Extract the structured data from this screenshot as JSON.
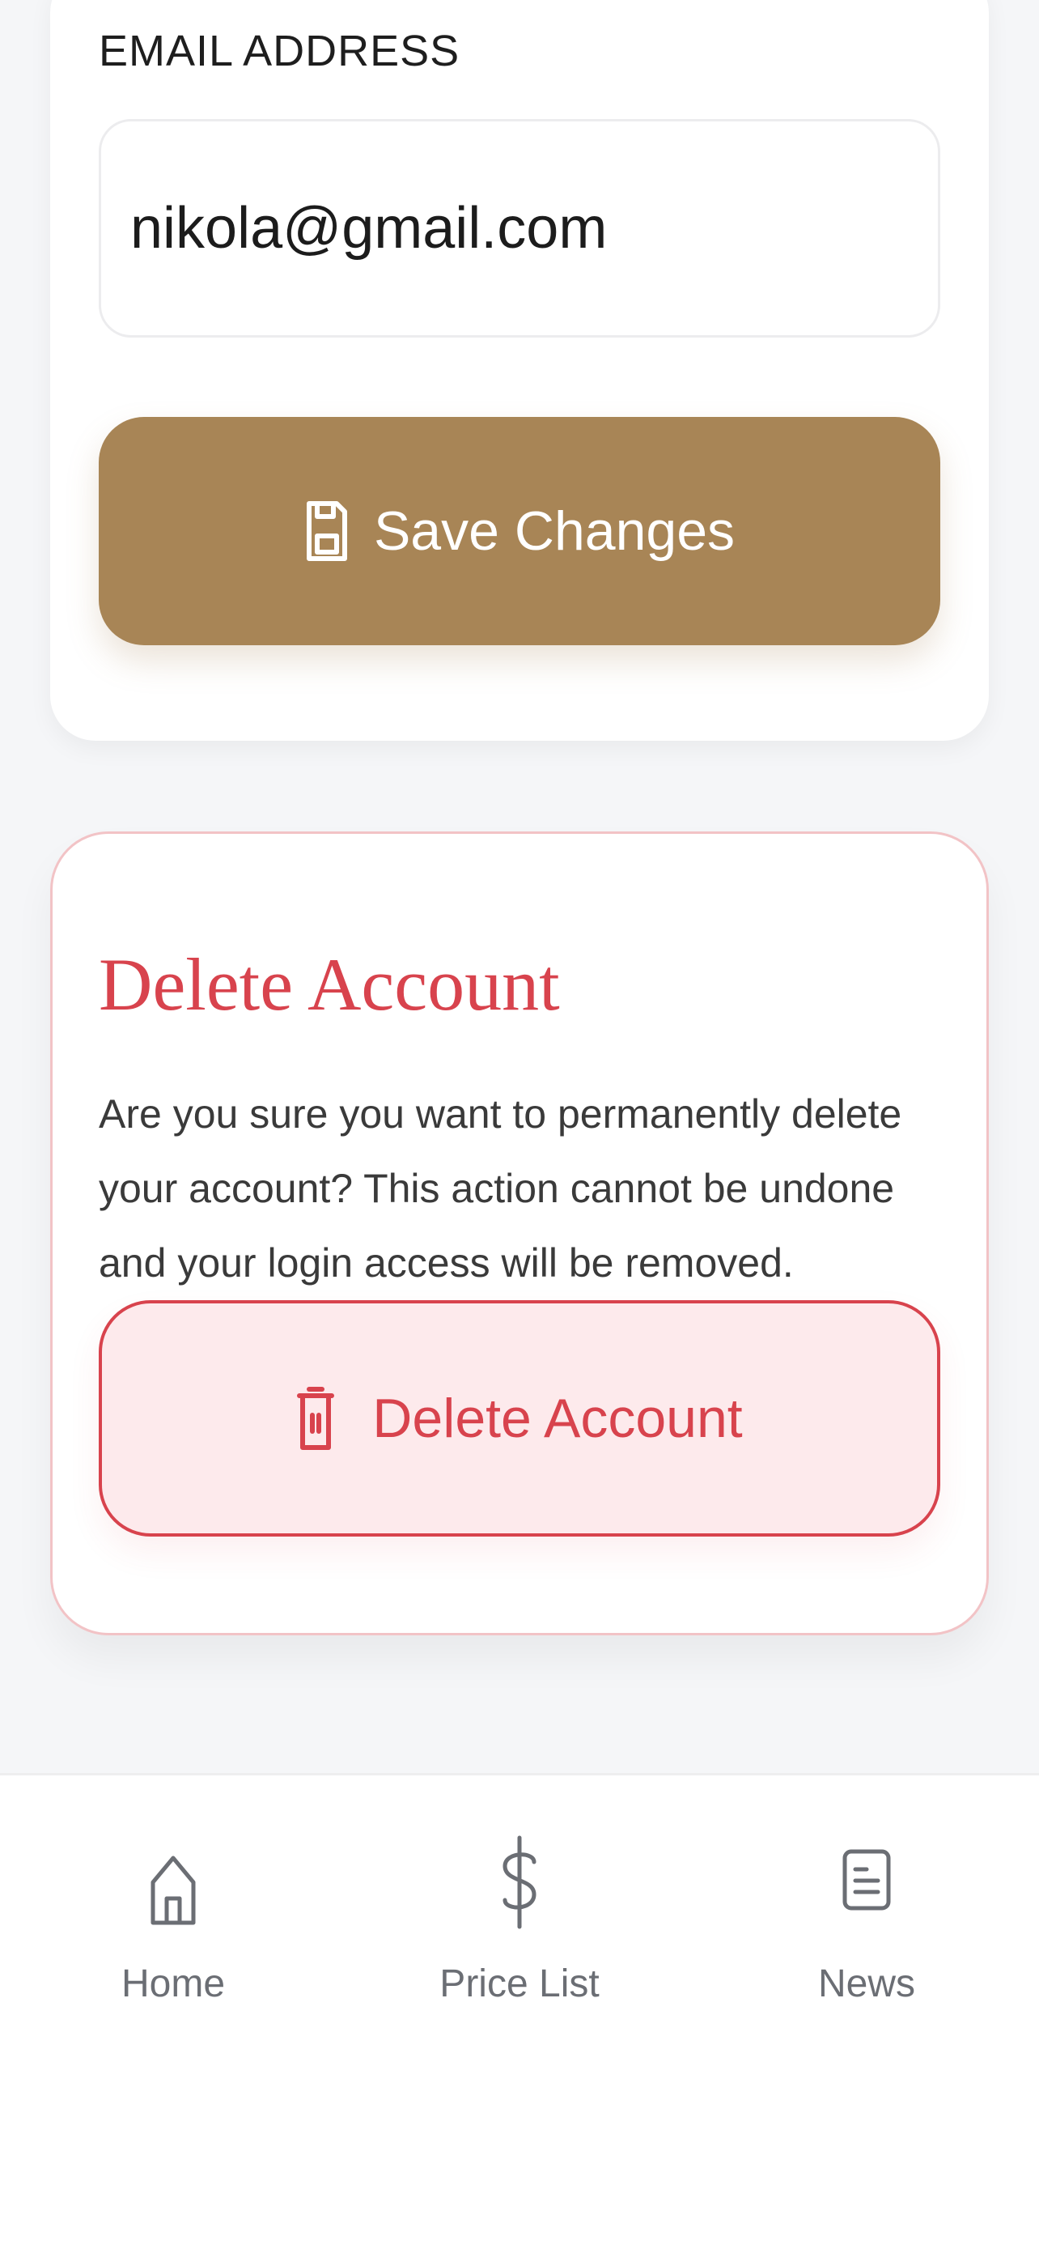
{
  "profile": {
    "email_label": "EMAIL ADDRESS",
    "email_value": "nikola@gmail.com",
    "save_label": "Save Changes"
  },
  "delete_section": {
    "title": "Delete Account",
    "description": "Are you sure you want to permanently delete your account? This action cannot be undone and your login access will be removed.",
    "button_label": "Delete Account"
  },
  "bottom_nav": {
    "items": [
      {
        "label": "Home",
        "icon": "home-icon"
      },
      {
        "label": "Price List",
        "icon": "dollar-icon"
      },
      {
        "label": "News",
        "icon": "news-icon"
      }
    ]
  },
  "colors": {
    "accent": "#a88556",
    "danger": "#d8434d",
    "danger_bg": "#fdeaec",
    "background": "#f5f6f8"
  }
}
